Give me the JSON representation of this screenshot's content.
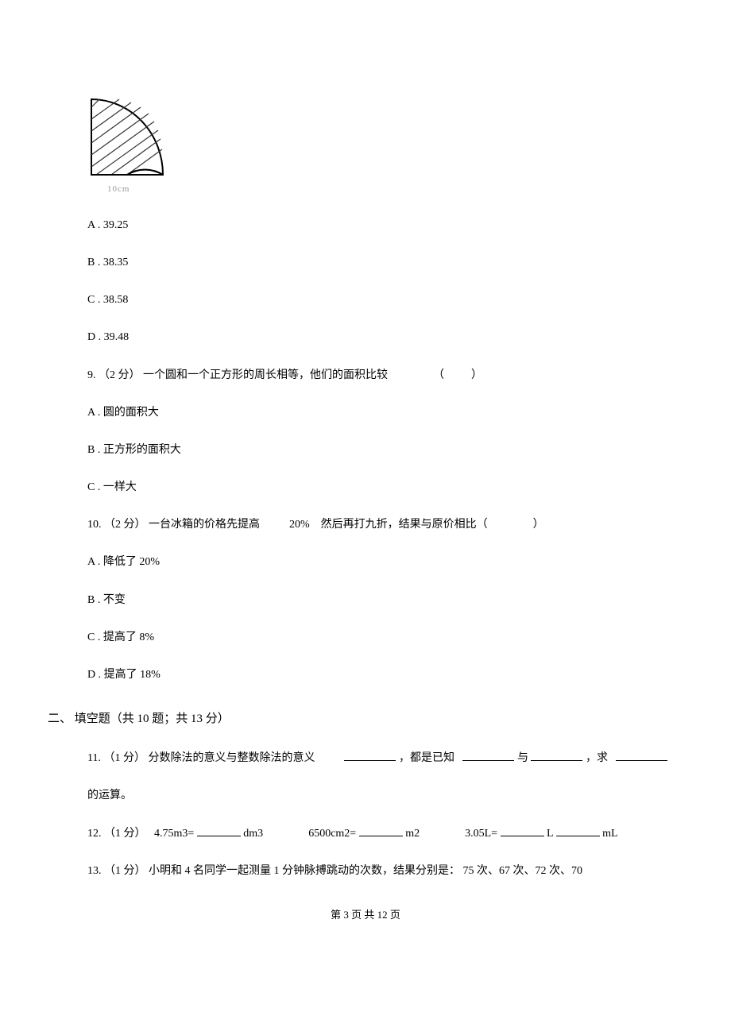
{
  "figure": {
    "caption": "10cm"
  },
  "prevOptions": {
    "a": "A . 39.25",
    "b": "B . 38.35",
    "c": "C . 38.58",
    "d": "D . 39.48"
  },
  "q9": {
    "num": "9.",
    "pts": "（2 分）",
    "text": "一个圆和一个正方形的周长相等，他们的面积比较",
    "paren": "（　　）",
    "a": "A .  圆的面积大",
    "b": "B .  正方形的面积大",
    "c": "C .  一样大"
  },
  "q10": {
    "num": "10.",
    "pts": "（2 分）",
    "text1": "一台冰箱的价格先提高",
    "pct": "20%",
    "text2": "然后再打九折，结果与原价相比（",
    "paren_close": "）",
    "a": "A .  降低了  20%",
    "b": "B .  不变",
    "c": "C .  提高了  8%",
    "d": "D .  提高了  18%"
  },
  "section2": {
    "header": "二、  填空题（共  10 题；共  13 分）"
  },
  "q11": {
    "num": "11.",
    "pts": "（1 分）",
    "text1": "分数除法的意义与整数除法的意义",
    "text2": "，都是已知",
    "text3": "与",
    "text4": "，求",
    "text5": "的运算。"
  },
  "q12": {
    "num": "12.",
    "pts": "（1 分）",
    "part1a": "4.75m3=",
    "part1b": "dm3",
    "part2a": "6500cm2=",
    "part2b": "m2",
    "part3a": "3.05L=",
    "part3b": "L",
    "part3c": "mL"
  },
  "q13": {
    "num": "13.",
    "pts": "（1 分）",
    "text": "小明和  4 名同学一起测量  1 分钟脉搏跳动的次数，结果分别是：  75 次、67 次、72 次、70"
  },
  "footer": "第  3 页 共  12 页"
}
